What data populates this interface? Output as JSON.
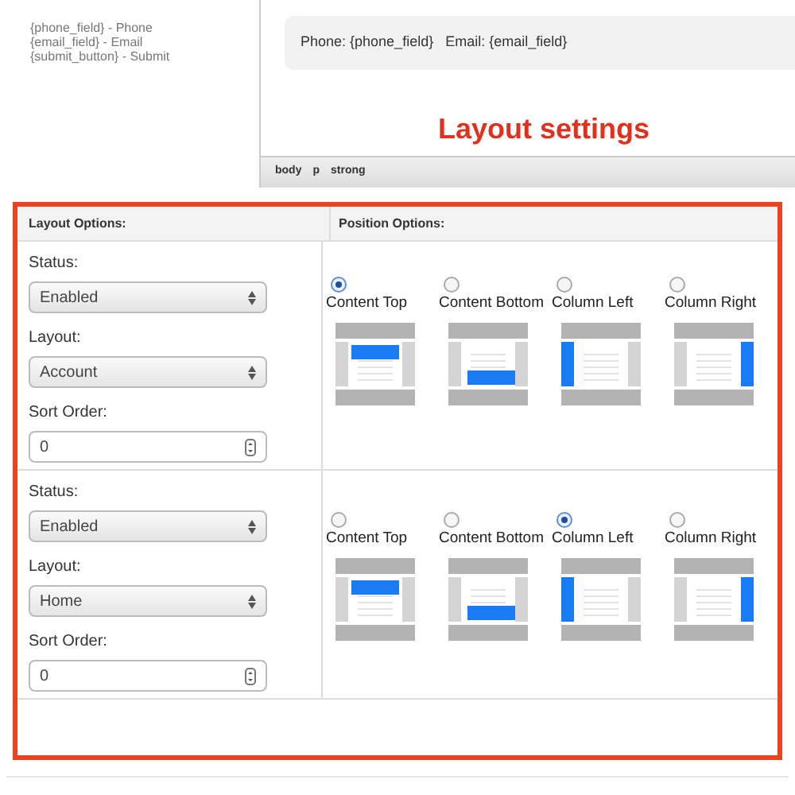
{
  "codes": [
    "{phone_field} - Phone",
    "{email_field} - Email",
    "{submit_button} - Submit"
  ],
  "editor": {
    "preview_text": "Phone: {phone_field}   Email: {email_field}",
    "status_path": [
      "body",
      "p",
      "strong"
    ]
  },
  "annotation": "Layout settings",
  "table": {
    "columns": [
      "Layout Options:",
      "Position Options:"
    ],
    "rows": [
      {
        "fields": [
          {
            "label": "Status:",
            "kind": "select",
            "value": "Enabled"
          },
          {
            "label": "Layout:",
            "kind": "select",
            "value": "Account"
          },
          {
            "label": "Sort Order:",
            "kind": "number",
            "value": "0"
          }
        ],
        "positions": [
          {
            "label": "Content Top",
            "kind": "top",
            "selected": true
          },
          {
            "label": "Content Bottom",
            "kind": "bottom",
            "selected": false
          },
          {
            "label": "Column Left",
            "kind": "left",
            "selected": false
          },
          {
            "label": "Column Right",
            "kind": "right",
            "selected": false
          }
        ]
      },
      {
        "fields": [
          {
            "label": "Status:",
            "kind": "select",
            "value": "Enabled"
          },
          {
            "label": "Layout:",
            "kind": "select",
            "value": "Home"
          },
          {
            "label": "Sort Order:",
            "kind": "number",
            "value": "0"
          }
        ],
        "positions": [
          {
            "label": "Content Top",
            "kind": "top",
            "selected": false
          },
          {
            "label": "Content Bottom",
            "kind": "bottom",
            "selected": false
          },
          {
            "label": "Column Left",
            "kind": "left",
            "selected": true
          },
          {
            "label": "Column Right",
            "kind": "right",
            "selected": false
          }
        ]
      }
    ]
  }
}
